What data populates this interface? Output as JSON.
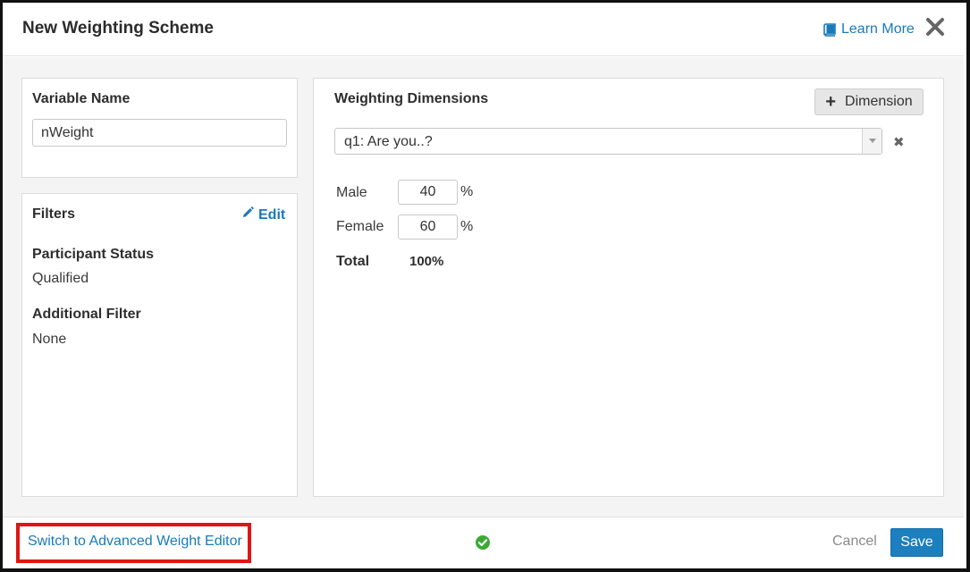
{
  "modal": {
    "title": "New Weighting Scheme",
    "learn_more_label": "Learn More",
    "close_icon": "close-icon"
  },
  "variable": {
    "label": "Variable Name",
    "value": "nWeight"
  },
  "filters": {
    "heading": "Filters",
    "edit_label": "Edit",
    "participant_status_label": "Participant Status",
    "participant_status_value": "Qualified",
    "additional_filter_label": "Additional Filter",
    "additional_filter_value": "None"
  },
  "dimensions": {
    "heading": "Weighting Dimensions",
    "add_button_label": "Dimension",
    "selected_question": "q1: Are you..?",
    "rows": [
      {
        "label": "Male",
        "value": "40",
        "unit": "%"
      },
      {
        "label": "Female",
        "value": "60",
        "unit": "%"
      }
    ],
    "total_label": "Total",
    "total_value": "100%"
  },
  "footer": {
    "switch_label": "Switch to Advanced Weight Editor",
    "cancel_label": "Cancel",
    "save_label": "Save"
  },
  "colors": {
    "accent": "#1a7ab8",
    "primary_button": "#1c7fbf",
    "valid_check": "#3aaa35",
    "highlight": "#e01515"
  }
}
